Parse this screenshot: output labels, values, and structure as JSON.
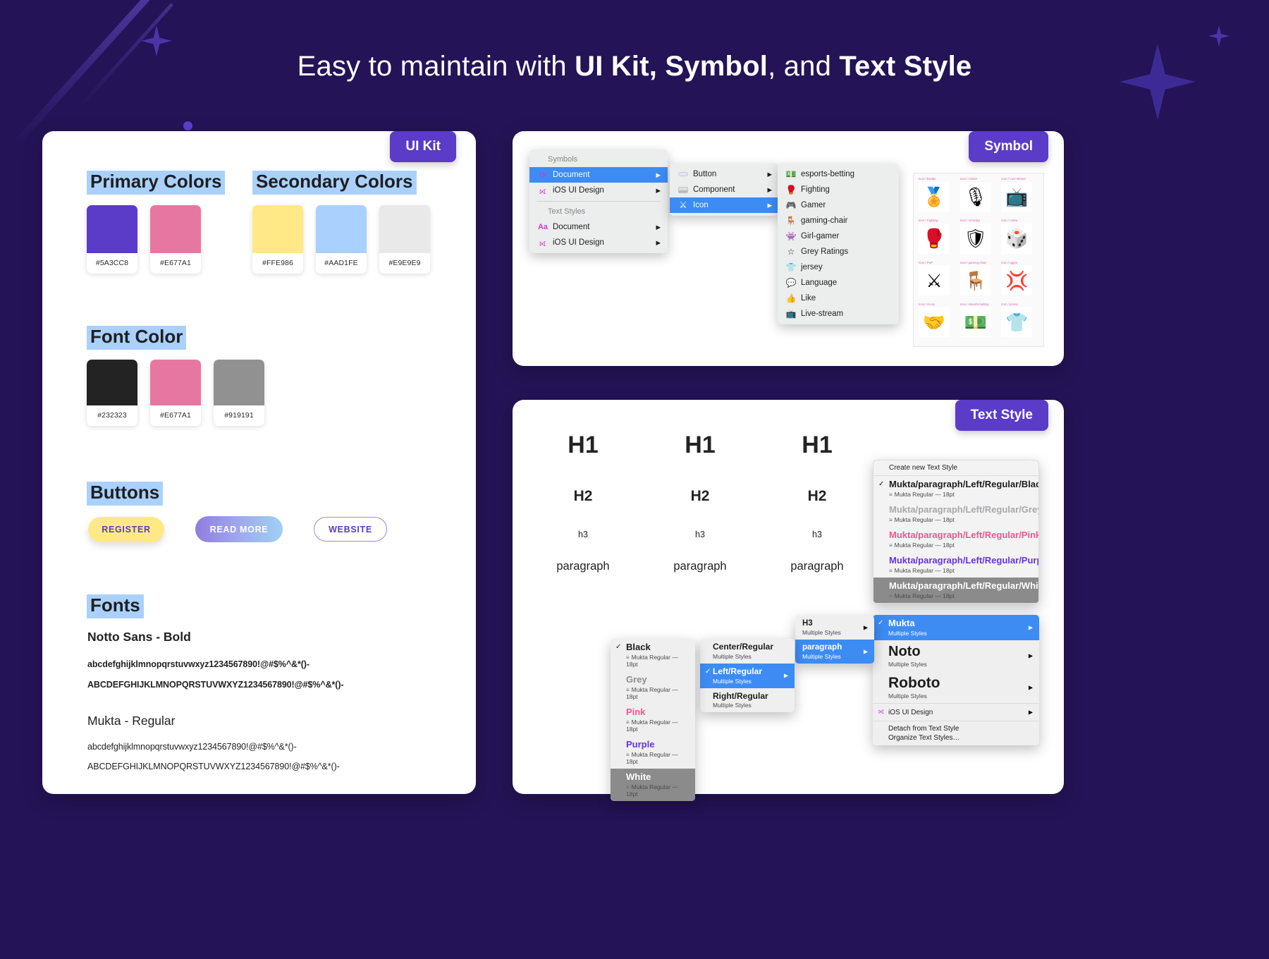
{
  "headline": {
    "part1": "Easy to maintain with ",
    "bold1": "UI Kit, Symbol",
    "part2": ", and ",
    "bold2": "Text Style"
  },
  "cards": {
    "uikit_tag": "UI Kit",
    "symbol_tag": "Symbol",
    "textstyle_tag": "Text Style"
  },
  "uikit": {
    "primary_title": "Primary Colors",
    "secondary_title": "Secondary Colors",
    "font_color_title": "Font Color",
    "buttons_title": "Buttons",
    "fonts_title": "Fonts",
    "primary_colors": [
      {
        "hex": "#5A3CC8",
        "label": "#5A3CC8"
      },
      {
        "hex": "#E677A1",
        "label": "#E677A1"
      }
    ],
    "secondary_colors": [
      {
        "hex": "#FFE986",
        "label": "#FFE986"
      },
      {
        "hex": "#AAD1FE",
        "label": "#AAD1FE"
      },
      {
        "hex": "#E9E9E9",
        "label": "#E9E9E9"
      }
    ],
    "font_colors": [
      {
        "hex": "#232323",
        "label": "#232323"
      },
      {
        "hex": "#E677A1",
        "label": "#E677A1"
      },
      {
        "hex": "#919191",
        "label": "#919191"
      }
    ],
    "buttons": [
      {
        "label": "REGISTER",
        "name": "register-button"
      },
      {
        "label": "READ MORE",
        "name": "read-more-button"
      },
      {
        "label": "WEBSITE",
        "name": "website-button"
      }
    ],
    "fonts": [
      {
        "name": "Notto Sans - Bold",
        "lower": "abcdefghijklmnopqrstuvwxyz1234567890!@#$%^&*()-",
        "upper": "ABCDEFGHIJKLMNOPQRSTUVWXYZ1234567890!@#$%^&*()-"
      },
      {
        "name": "Mukta - Regular",
        "lower": "abcdefghijklmnopqrstuvwxyz1234567890!@#$%^&*()-",
        "upper": "ABCDEFGHIJKLMNOPQRSTUVWXYZ1234567890!@#$%^&*()-"
      }
    ]
  },
  "symbol": {
    "menu1": {
      "header_symbols": "Symbols",
      "header_textstyles": "Text Styles",
      "items": [
        {
          "label": "Document",
          "icon": "sketch-symbol-icon",
          "selected": true
        },
        {
          "label": "iOS UI Design",
          "icon": "sketch-symbol-icon",
          "selected": false
        }
      ],
      "text_items": [
        {
          "label": "Document",
          "icon": "text-style-aa-icon",
          "selected": false
        },
        {
          "label": "iOS UI Design",
          "icon": "sketch-symbol-icon",
          "selected": false
        }
      ]
    },
    "menu2": {
      "items": [
        {
          "label": "Button",
          "icon": "pill-button-icon",
          "selected": false
        },
        {
          "label": "Component",
          "icon": "component-icon",
          "selected": false
        },
        {
          "label": "Icon",
          "icon": "aggro-icon",
          "selected": true
        }
      ]
    },
    "menu3": {
      "items": [
        {
          "label": "esports-betting",
          "glyph": "💵"
        },
        {
          "label": "Fighting",
          "glyph": "🥊"
        },
        {
          "label": "Gamer",
          "glyph": "🎮"
        },
        {
          "label": "gaming-chair",
          "glyph": "🪑"
        },
        {
          "label": "Girl-gamer",
          "glyph": "👾"
        },
        {
          "label": "Grey Ratings",
          "glyph": "☆"
        },
        {
          "label": "jersey",
          "glyph": "👕"
        },
        {
          "label": "Language",
          "glyph": "💬"
        },
        {
          "label": "Like",
          "glyph": "👍"
        },
        {
          "label": "Live-stream",
          "glyph": "📺"
        }
      ]
    },
    "icon_grid": [
      {
        "caption": "Icon / Badge",
        "glyph": "🏅"
      },
      {
        "caption": "Icon / Caster",
        "glyph": "🎙"
      },
      {
        "caption": "Icon / Live-stream",
        "glyph": "📺"
      },
      {
        "caption": "Icon / Fighting",
        "glyph": "🥊"
      },
      {
        "caption": "Icon / mmorpg",
        "glyph": "🛡"
      },
      {
        "caption": "Icon / moba",
        "glyph": "🎲"
      },
      {
        "caption": "Icon / PvP",
        "glyph": "⚔"
      },
      {
        "caption": "Icon / gaming-chair",
        "glyph": "🪑"
      },
      {
        "caption": "Icon / aggro",
        "glyph": "💢"
      },
      {
        "caption": "Icon / co-op",
        "glyph": "🤝"
      },
      {
        "caption": "Icon / esports-betting",
        "glyph": "💵"
      },
      {
        "caption": "Icon / jersey",
        "glyph": "👕"
      }
    ]
  },
  "textstyle": {
    "columns": [
      {
        "h1": "H1",
        "h2": "H2",
        "h3": "h3",
        "p": "paragraph"
      },
      {
        "h1": "H1",
        "h2": "H2",
        "h3": "h3",
        "p": "paragraph"
      },
      {
        "h1": "H1",
        "h2": "H2",
        "h3": "h3",
        "p": "paragraph"
      }
    ],
    "styles_menu": {
      "create_label": "Create new Text Style",
      "meta": "Mukta Regular — 18pt",
      "items": [
        {
          "label": "Mukta/paragraph/Left/Regular/Black",
          "color": "#1d1d1f",
          "checked": true,
          "highlight": false
        },
        {
          "label": "Mukta/paragraph/Left/Regular/Grey",
          "color": "#a8a8ab",
          "checked": false,
          "highlight": false
        },
        {
          "label": "Mukta/paragraph/Left/Regular/Pink",
          "color": "#f2568f",
          "checked": false,
          "highlight": false
        },
        {
          "label": "Mukta/paragraph/Left/Regular/Purple",
          "color": "#6336e0",
          "checked": false,
          "highlight": false
        },
        {
          "label": "Mukta/paragraph/Left/Regular/White",
          "color": "#ffffff",
          "checked": false,
          "highlight": true
        }
      ]
    },
    "family_menu": {
      "items": [
        {
          "label": "Mukta",
          "sub": "Multiple Styles",
          "selected": true,
          "checked": true,
          "size": 13
        },
        {
          "label": "Noto",
          "sub": "Multiple Styles",
          "selected": false,
          "checked": false,
          "size": 20
        },
        {
          "label": "Roboto",
          "sub": "Multiple Styles",
          "selected": false,
          "checked": false,
          "size": 21
        }
      ],
      "library": "iOS UI Design",
      "actions": [
        "Detach from Text Style",
        "Organize Text Styles…"
      ]
    },
    "color_menu": {
      "meta": "Mukta Regular — 18pt",
      "items": [
        {
          "label": "Black",
          "color": "#1d1d1f",
          "checked": true,
          "highlight": false
        },
        {
          "label": "Grey",
          "color": "#8d8d90",
          "checked": false,
          "highlight": false
        },
        {
          "label": "Pink",
          "color": "#f2568f",
          "checked": false,
          "highlight": false
        },
        {
          "label": "Purple",
          "color": "#6336e0",
          "checked": false,
          "highlight": false
        },
        {
          "label": "White",
          "color": "#ffffff",
          "checked": false,
          "highlight": true
        }
      ]
    },
    "align_menu": {
      "sub": "Multiple Styles",
      "items": [
        {
          "label": "Center/Regular",
          "selected": false
        },
        {
          "label": "Left/Regular",
          "selected": true
        },
        {
          "label": "Right/Regular",
          "selected": false
        }
      ]
    },
    "level_menu": {
      "sub": "Multiple Styles",
      "items": [
        {
          "label": "H3",
          "selected": false
        },
        {
          "label": "paragraph",
          "selected": true
        }
      ]
    }
  }
}
